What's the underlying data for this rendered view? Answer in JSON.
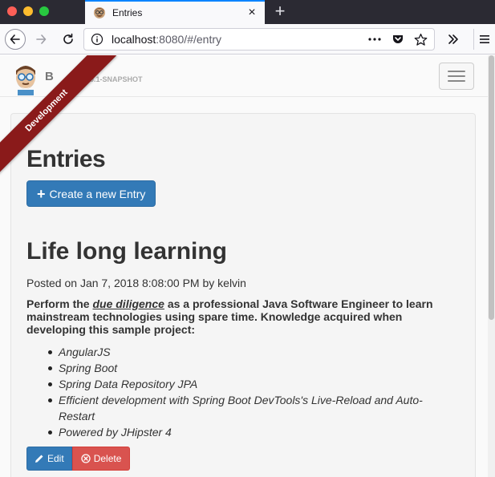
{
  "browser": {
    "tab_title": "Entries",
    "tab_close": "×",
    "new_tab": "+",
    "url_host": "localhost",
    "url_path": ":8080/#/entry",
    "tab_accent": "#0a84ff"
  },
  "app": {
    "brand": "B",
    "version": "0.1-SNAPSHOT",
    "ribbon": "Development",
    "ribbon_color": "#8a1a1a"
  },
  "page": {
    "heading": "Entries",
    "create_button": "Create a new Entry",
    "create_icon": "+"
  },
  "entry": {
    "title": "Life long learning",
    "meta": "Posted on Jan 7, 2018 8:08:00 PM by kelvin",
    "body_prefix": "Perform the ",
    "body_emphasis": "due diligence",
    "body_suffix": " as a professional Java Software Engineer to learn mainstream technologies using spare time. Knowledge acquired when developing this sample project:",
    "items": [
      "AngularJS",
      "Spring Boot",
      "Spring Data Repository JPA",
      "Efficient development with Spring Boot DevTools's Live-Reload and Auto-Restart",
      "Powered by JHipster 4"
    ],
    "edit_label": "Edit",
    "delete_label": "Delete"
  },
  "colors": {
    "primary": "#337ab7",
    "danger": "#d9534f"
  },
  "icons": {
    "back": "arrow-left-icon",
    "forward": "arrow-right-icon",
    "reload": "reload-icon",
    "info": "info-icon",
    "more": "more-dots-icon",
    "pocket": "pocket-icon",
    "bookmark": "star-icon",
    "overflow": "double-chevron-icon",
    "menu": "hamburger-icon",
    "edit": "pencil-icon",
    "delete": "circle-x-icon"
  }
}
